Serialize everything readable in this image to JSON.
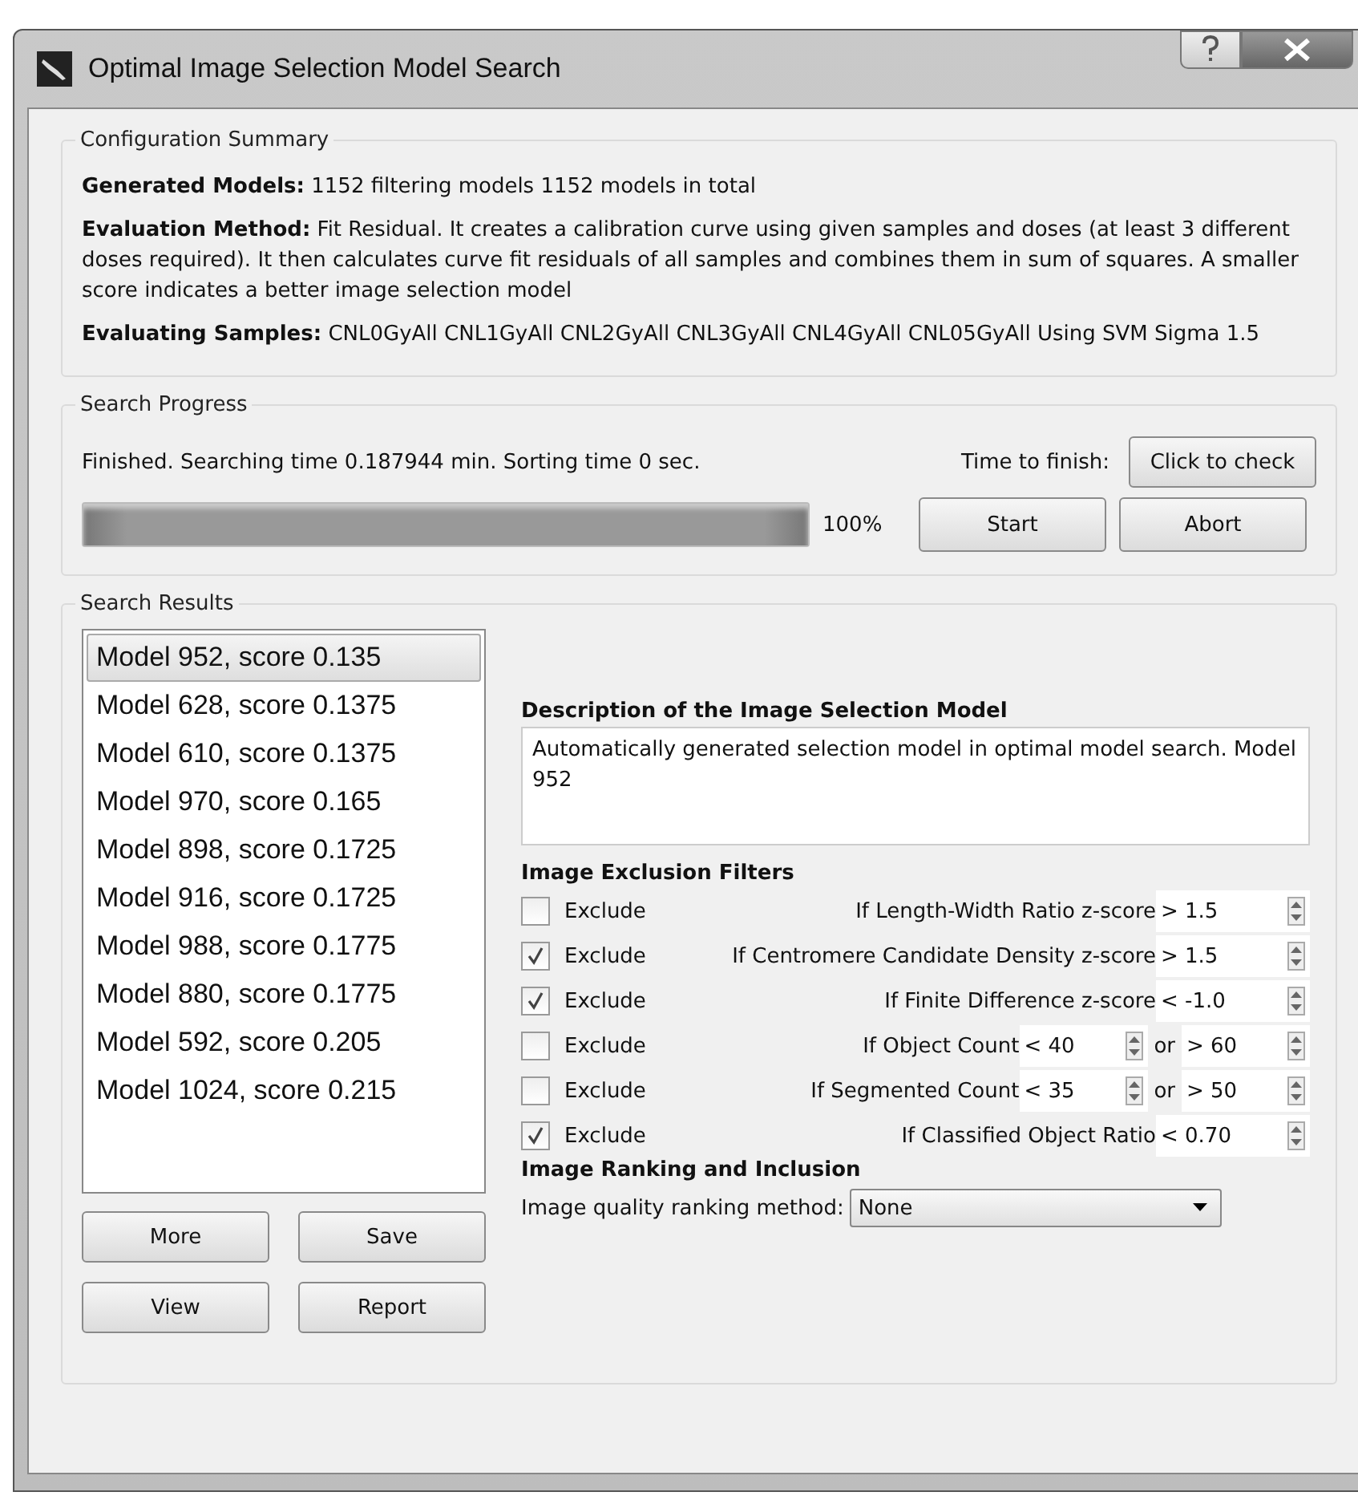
{
  "window": {
    "title": "Optimal Image Selection Model Search"
  },
  "configuration_summary": {
    "title": "Configuration Summary",
    "lines": [
      {
        "label": "Generated Models:",
        "text": "1152 filtering models 1152 models in total"
      },
      {
        "label": "Evaluation Method:",
        "text": "Fit Residual. It creates a calibration curve using given samples and doses (at least 3 different doses required). It then calculates curve fit residuals of all samples and combines them in sum of squares. A smaller score indicates a better image selection model"
      },
      {
        "label": "Evaluating Samples:",
        "text": "CNL0GyAll CNL1GyAll CNL2GyAll CNL3GyAll CNL4GyAll CNL05GyAll Using SVM Sigma 1.5"
      }
    ]
  },
  "search_progress": {
    "title": "Search Progress",
    "status": "Finished. Searching time 0.187944 min. Sorting time 0 sec.",
    "time_label": "Time to finish:",
    "check_button": "Click to check",
    "level": 1,
    "percent": "100%",
    "buttons": [
      "Start",
      "Abort"
    ]
  },
  "search_results": {
    "title": "Search Results",
    "models": [
      {
        "label": "Model 952, score 0.135",
        "selected": true
      },
      {
        "label": "Model 628, score 0.1375",
        "selected": false
      },
      {
        "label": "Model 610, score 0.1375",
        "selected": false
      },
      {
        "label": "Model 970, score 0.165",
        "selected": false
      },
      {
        "label": "Model 898, score 0.1725",
        "selected": false
      },
      {
        "label": "Model 916, score 0.1725",
        "selected": false
      },
      {
        "label": "Model 988, score 0.1775",
        "selected": false
      },
      {
        "label": "Model 880, score 0.1775",
        "selected": false
      },
      {
        "label": "Model 592, score 0.205",
        "selected": false
      },
      {
        "label": "Model 1024, score 0.215",
        "selected": false
      }
    ],
    "buttons": [
      "More",
      "Save",
      "View",
      "Report"
    ],
    "description_title": "Description of the Image Selection Model",
    "description": "Automatically generated selection model in optimal model search. Model 952",
    "filters_title": "Image Exclusion Filters",
    "filters": [
      {
        "checked": false,
        "label": "Exclude",
        "condition": "If Length-Width Ratio z-score",
        "values": [
          "> 1.5"
        ]
      },
      {
        "checked": true,
        "label": "Exclude",
        "condition": "If Centromere Candidate Density z-score",
        "values": [
          "> 1.5"
        ]
      },
      {
        "checked": true,
        "label": "Exclude",
        "condition": "If Finite Difference z-score",
        "values": [
          "< -1.0"
        ]
      },
      {
        "checked": false,
        "label": "Exclude",
        "condition": "If Object Count",
        "values": [
          "< 40",
          "> 60"
        ],
        "joiner": "or"
      },
      {
        "checked": false,
        "label": "Exclude",
        "condition": "If Segmented Count",
        "values": [
          "< 35",
          "> 50"
        ],
        "joiner": "or"
      },
      {
        "checked": true,
        "label": "Exclude",
        "condition": "If Classified Object Ratio",
        "values": [
          "< 0.70"
        ]
      }
    ],
    "ranking_title": "Image Ranking and Inclusion",
    "ranking_label": "Image quality ranking method:",
    "ranking_value": "None"
  }
}
